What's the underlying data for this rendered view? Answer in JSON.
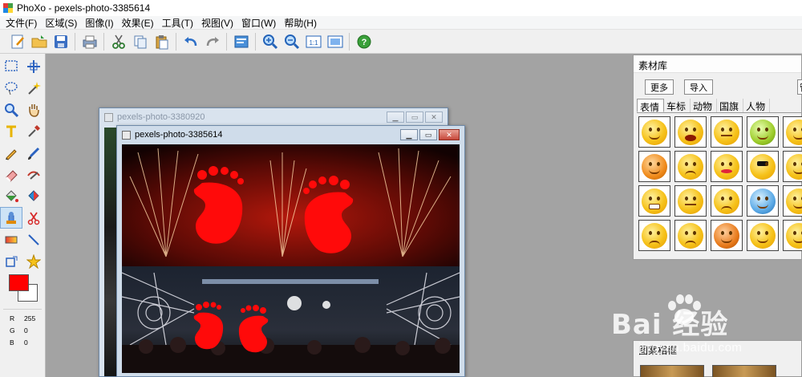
{
  "app": {
    "title": "PhoXo - pexels-photo-3385614",
    "logo_colors": [
      "#e53935",
      "#43a047",
      "#1e88e5",
      "#fdd835"
    ]
  },
  "menu": [
    "文件(F)",
    "区域(S)",
    "图像(I)",
    "效果(E)",
    "工具(T)",
    "视图(V)",
    "窗口(W)",
    "帮助(H)"
  ],
  "toolbar": {
    "zoom_actual_label": "1:1"
  },
  "color": {
    "fg": "#ff0000",
    "bg": "#ffffff",
    "r_label": "R",
    "r_value": "255",
    "g_label": "G",
    "g_value": "0",
    "b_label": "B",
    "b_value": "0"
  },
  "back_window": {
    "title": "pexels-photo-3380920"
  },
  "front_window": {
    "title": "pexels-photo-3385614"
  },
  "material_panel": {
    "title": "素材库",
    "more_button": "更多",
    "import_button": "导入",
    "extra_button": "管",
    "tabs": [
      "表情",
      "车标",
      "动物",
      "国旗",
      "人物"
    ],
    "active_tab": "表情"
  },
  "frame_panel": {
    "title": "图案相框"
  },
  "watermark": {
    "brand": "Bai  经验",
    "site": "jingyan.baidu.com"
  }
}
